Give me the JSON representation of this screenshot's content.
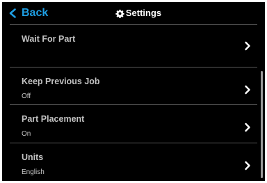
{
  "header": {
    "back_label": "Back",
    "back_icon": "chevron-left-icon",
    "title": "Settings",
    "title_icon": "gear-icon"
  },
  "colors": {
    "background": "#000000",
    "accent": "#1e9ee3",
    "text": "#c2c2c2",
    "divider": "#5a5a5a"
  },
  "settings": [
    {
      "label": "Wait For Part",
      "value": ""
    },
    {
      "label": "Keep Previous Job",
      "value": "Off"
    },
    {
      "label": "Part Placement",
      "value": "On"
    },
    {
      "label": "Units",
      "value": "English"
    }
  ],
  "row_icon": "chevron-right-icon"
}
